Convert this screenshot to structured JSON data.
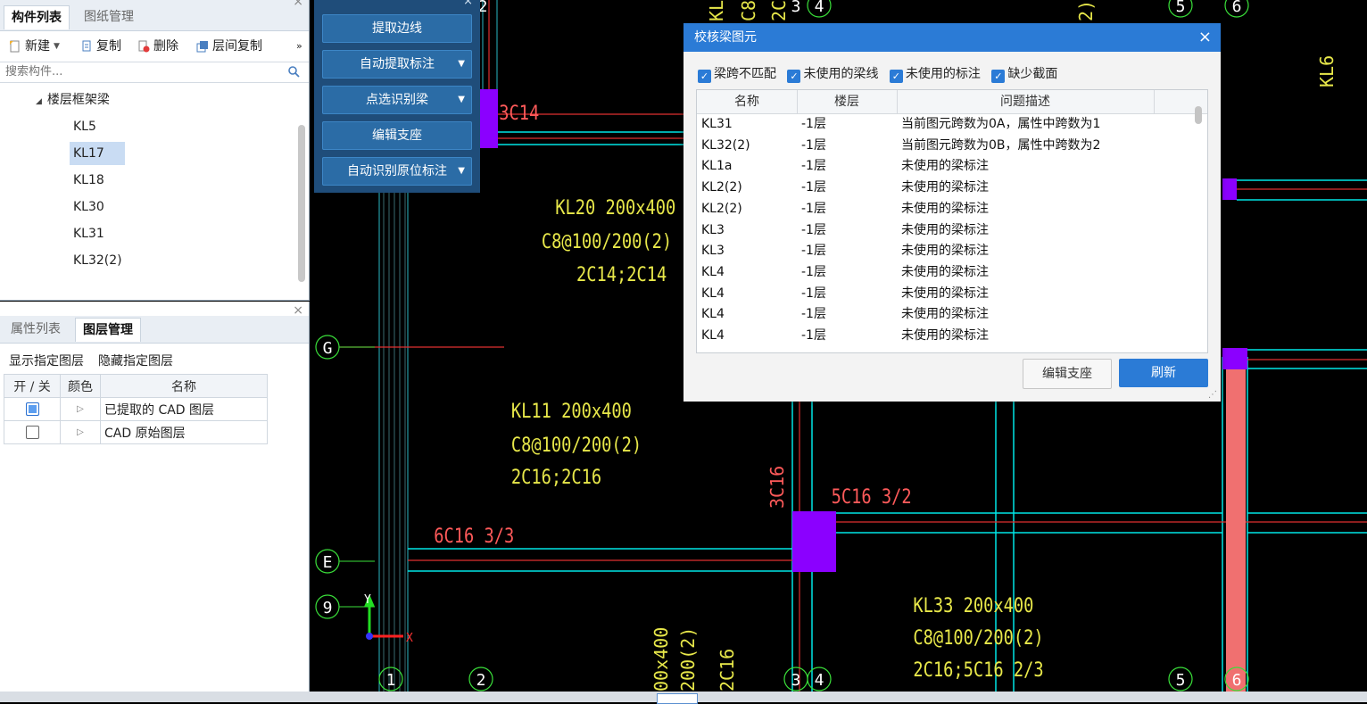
{
  "component_panel": {
    "tabs": [
      "构件列表",
      "图纸管理"
    ],
    "toolbar": {
      "new": "新建",
      "copy": "复制",
      "delete": "删除",
      "floor_copy": "层间复制",
      "more": "»"
    },
    "search_placeholder": "搜索构件...",
    "tree_group": "楼层框架梁",
    "items": [
      "KL5",
      "KL17",
      "KL18",
      "KL30",
      "KL31",
      "KL32(2)"
    ],
    "selected": "KL17"
  },
  "layer_panel": {
    "tabs": [
      "属性列表",
      "图层管理"
    ],
    "actions": [
      "显示指定图层",
      "隐藏指定图层"
    ],
    "columns": [
      "开 / 关",
      "颜色",
      "名称"
    ],
    "rows": [
      {
        "name": "已提取的 CAD 图层",
        "on": true
      },
      {
        "name": "CAD 原始图层",
        "on": false
      }
    ]
  },
  "tool_panel": {
    "buttons": [
      {
        "label": "提取边线",
        "dropdown": false
      },
      {
        "label": "自动提取标注",
        "dropdown": true
      },
      {
        "label": "点选识别梁",
        "dropdown": true
      },
      {
        "label": "编辑支座",
        "dropdown": false
      },
      {
        "label": "自动识别原位标注",
        "dropdown": true
      }
    ]
  },
  "dialog": {
    "title": "校核梁图元",
    "filters": [
      "梁跨不匹配",
      "未使用的梁线",
      "未使用的标注",
      "缺少截面"
    ],
    "columns": [
      "名称",
      "楼层",
      "问题描述"
    ],
    "rows": [
      [
        "KL31",
        "-1层",
        "当前图元跨数为0A，属性中跨数为1"
      ],
      [
        "KL32(2)",
        "-1层",
        "当前图元跨数为0B，属性中跨数为2"
      ],
      [
        "KL1a",
        "-1层",
        "未使用的梁标注"
      ],
      [
        "KL2(2)",
        "-1层",
        "未使用的梁标注"
      ],
      [
        "KL2(2)",
        "-1层",
        "未使用的梁标注"
      ],
      [
        "KL3",
        "-1层",
        "未使用的梁标注"
      ],
      [
        "KL3",
        "-1层",
        "未使用的梁标注"
      ],
      [
        "KL4",
        "-1层",
        "未使用的梁标注"
      ],
      [
        "KL4",
        "-1层",
        "未使用的梁标注"
      ],
      [
        "KL4",
        "-1层",
        "未使用的梁标注"
      ],
      [
        "KL4",
        "-1层",
        "未使用的梁标注"
      ]
    ],
    "edit_support_button": "编辑支座",
    "refresh_button": "刷新",
    "close": "×"
  },
  "cad": {
    "annotations": [
      "KL20 200x400",
      "C8@100/200(2)",
      "2C14;2C14",
      "KL11 200x400",
      "C8@100/200(2)",
      "2C16;2C16",
      "6C16 3/3",
      "3C14",
      "3C16",
      "5C16 3/2",
      "KL33 200x400",
      "C8@100/200(2)",
      "2C16;5C16 2/3",
      "KL6",
      "00x400",
      "200(2)",
      "2C16",
      "2)",
      "KL3",
      "C8",
      "2C"
    ],
    "axis_labels": [
      "G",
      "E",
      "9",
      "1",
      "2",
      "3",
      "4",
      "5",
      "6"
    ],
    "top_axis_labels": [
      "2",
      "3",
      "4",
      "5",
      "6"
    ],
    "ucs": {
      "x": "X",
      "y": "Y"
    }
  },
  "colors": {
    "accent": "#2b7bd6",
    "annotation": "#e8e84a",
    "red_annotation": "#ff5a5a",
    "beam": "#00e5e5"
  }
}
